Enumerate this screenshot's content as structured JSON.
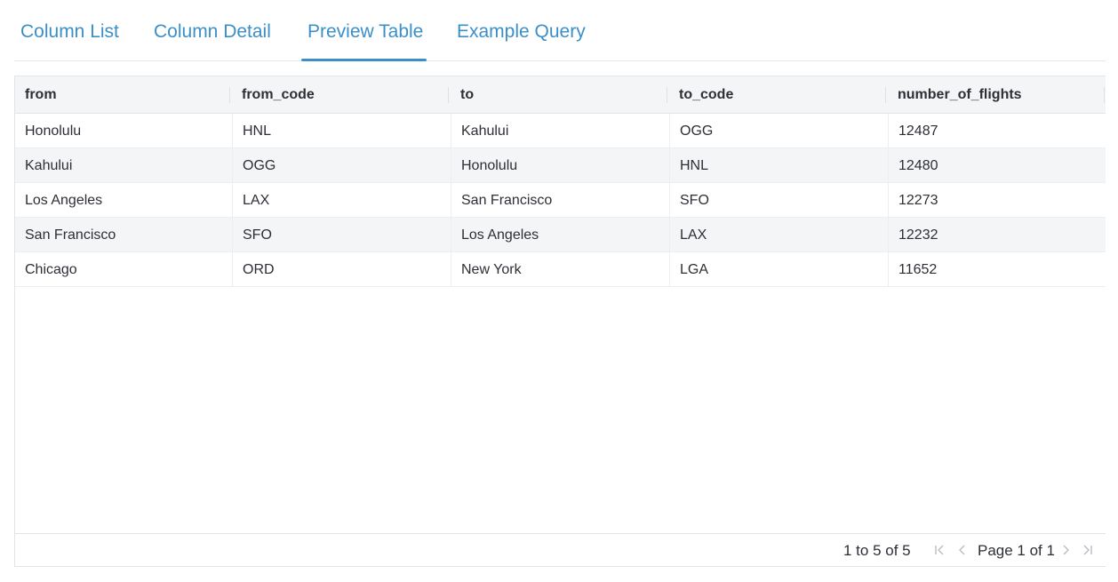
{
  "tabs": [
    {
      "label": "Column List"
    },
    {
      "label": "Column Detail"
    },
    {
      "label": "Preview Table"
    },
    {
      "label": "Example Query"
    }
  ],
  "active_tab": "Preview Table",
  "table": {
    "columns": [
      "from",
      "from_code",
      "to",
      "to_code",
      "number_of_flights"
    ],
    "rows": [
      [
        "Honolulu",
        "HNL",
        "Kahului",
        "OGG",
        "12487"
      ],
      [
        "Kahului",
        "OGG",
        "Honolulu",
        "HNL",
        "12480"
      ],
      [
        "Los Angeles",
        "LAX",
        "San Francisco",
        "SFO",
        "12273"
      ],
      [
        "San Francisco",
        "SFO",
        "Los Angeles",
        "LAX",
        "12232"
      ],
      [
        "Chicago",
        "ORD",
        "New York",
        "LGA",
        "11652"
      ]
    ]
  },
  "pagination": {
    "summary": "1 to 5 of 5",
    "page_label": "Page 1 of 1"
  },
  "colors": {
    "accent": "#3b8fc9",
    "header_bg": "#f4f5f7",
    "disabled_icon": "#b9bcc2"
  },
  "icons": {
    "first": "first-page-icon",
    "prev": "previous-page-icon",
    "next": "next-page-icon",
    "last": "last-page-icon"
  }
}
